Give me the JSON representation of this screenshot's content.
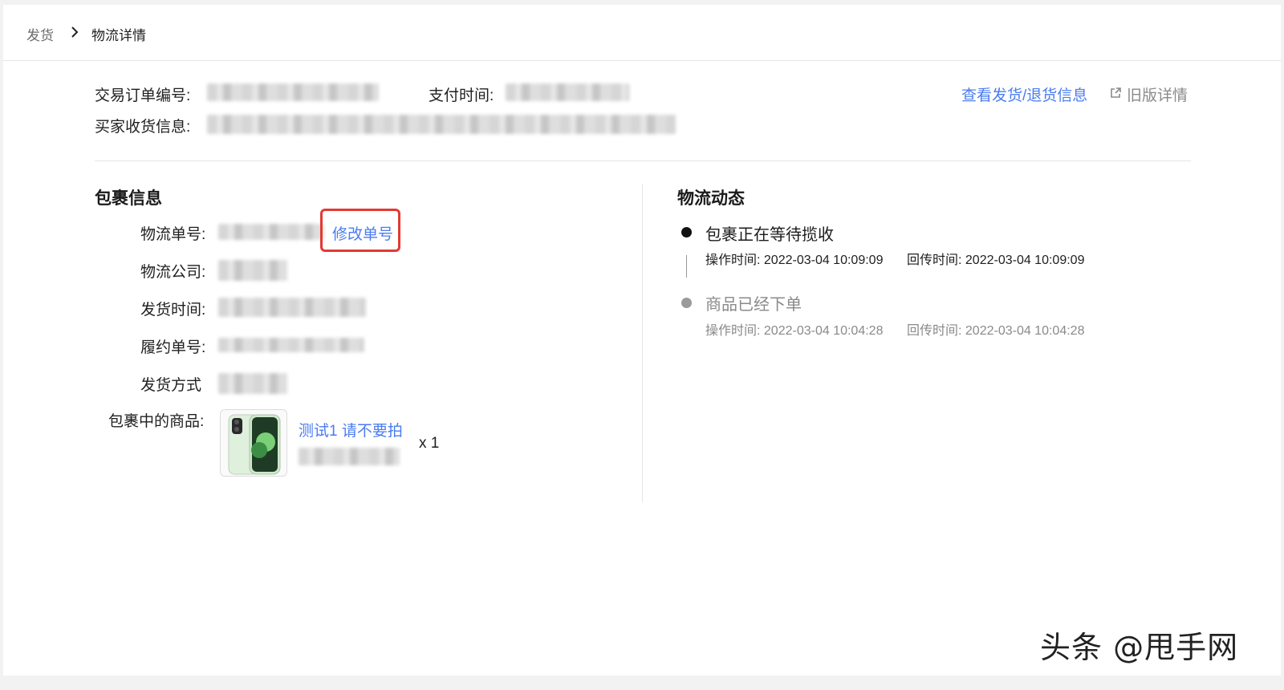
{
  "breadcrumb": {
    "root": "发货",
    "current": "物流详情"
  },
  "order": {
    "order_no_label": "交易订单编号:",
    "pay_time_label": "支付时间:",
    "buyer_label": "买家收货信息:",
    "view_shipping_link": "查看发货/退货信息",
    "old_details_link": "旧版详情"
  },
  "package": {
    "title": "包裹信息",
    "tracking_no_label": "物流单号:",
    "edit_tracking_link": "修改单号",
    "carrier_label": "物流公司:",
    "ship_time_label": "发货时间:",
    "fulfill_no_label": "履约单号:",
    "ship_method_label": "发货方式",
    "items_label": "包裹中的商品:",
    "item": {
      "name": "测试1 请不要拍",
      "qty": "x 1"
    }
  },
  "logistics": {
    "title": "物流动态",
    "events": [
      {
        "title": "包裹正在等待揽收",
        "op_time": "操作时间: 2022-03-04 10:09:09",
        "return_time": "回传时间: 2022-03-04 10:09:09",
        "active": true
      },
      {
        "title": "商品已经下单",
        "op_time": "操作时间: 2022-03-04 10:04:28",
        "return_time": "回传时间: 2022-03-04 10:04:28",
        "active": false
      }
    ]
  },
  "colors": {
    "link": "#4a7cf0",
    "highlight": "#e23a32",
    "active_dot": "#111111",
    "inactive_dot": "#9a9a9a"
  },
  "watermark": "头条 @甩手网"
}
